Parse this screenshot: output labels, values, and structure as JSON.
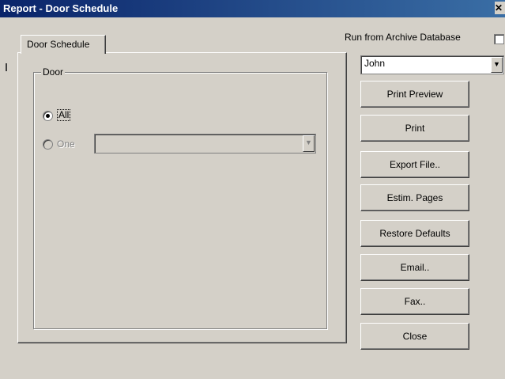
{
  "window": {
    "title": "Report  - Door Schedule",
    "close_glyph": "✕"
  },
  "tab": {
    "label": "Door Schedule"
  },
  "archive": {
    "label": "Run from Archive Database",
    "checked": false
  },
  "user_select": {
    "value": "John"
  },
  "group": {
    "label": "Door",
    "options": [
      {
        "label": "All",
        "checked": true,
        "enabled": true
      },
      {
        "label": "One",
        "checked": false,
        "enabled": false
      }
    ],
    "one_select_value": ""
  },
  "buttons": [
    {
      "id": "print-preview",
      "label": "Print Preview"
    },
    {
      "id": "print",
      "label": "Print"
    },
    {
      "id": "export-file",
      "label": "Export File.."
    },
    {
      "id": "estim-pages",
      "label": "Estim. Pages"
    },
    {
      "id": "restore-defaults",
      "label": "Restore Defaults"
    },
    {
      "id": "email",
      "label": "Email.."
    },
    {
      "id": "fax",
      "label": "Fax.."
    },
    {
      "id": "close",
      "label": "Close"
    }
  ]
}
